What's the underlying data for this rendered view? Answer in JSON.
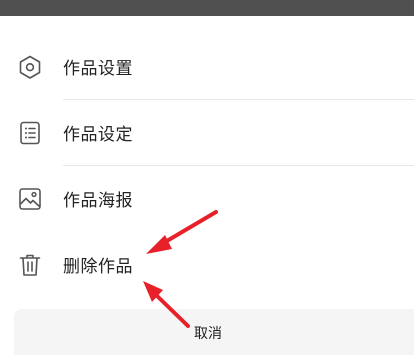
{
  "menu": {
    "items": [
      {
        "label": "作品设置",
        "icon": "hexagon-settings-icon"
      },
      {
        "label": "作品设定",
        "icon": "list-document-icon"
      },
      {
        "label": "作品海报",
        "icon": "image-poster-icon"
      },
      {
        "label": "删除作品",
        "icon": "trash-icon"
      }
    ]
  },
  "cancel": {
    "label": "取消"
  },
  "colors": {
    "arrow": "#e8202a",
    "top_bar": "#505050",
    "cancel_bg": "#f5f5f5",
    "text": "#222222",
    "icon": "#555555"
  }
}
